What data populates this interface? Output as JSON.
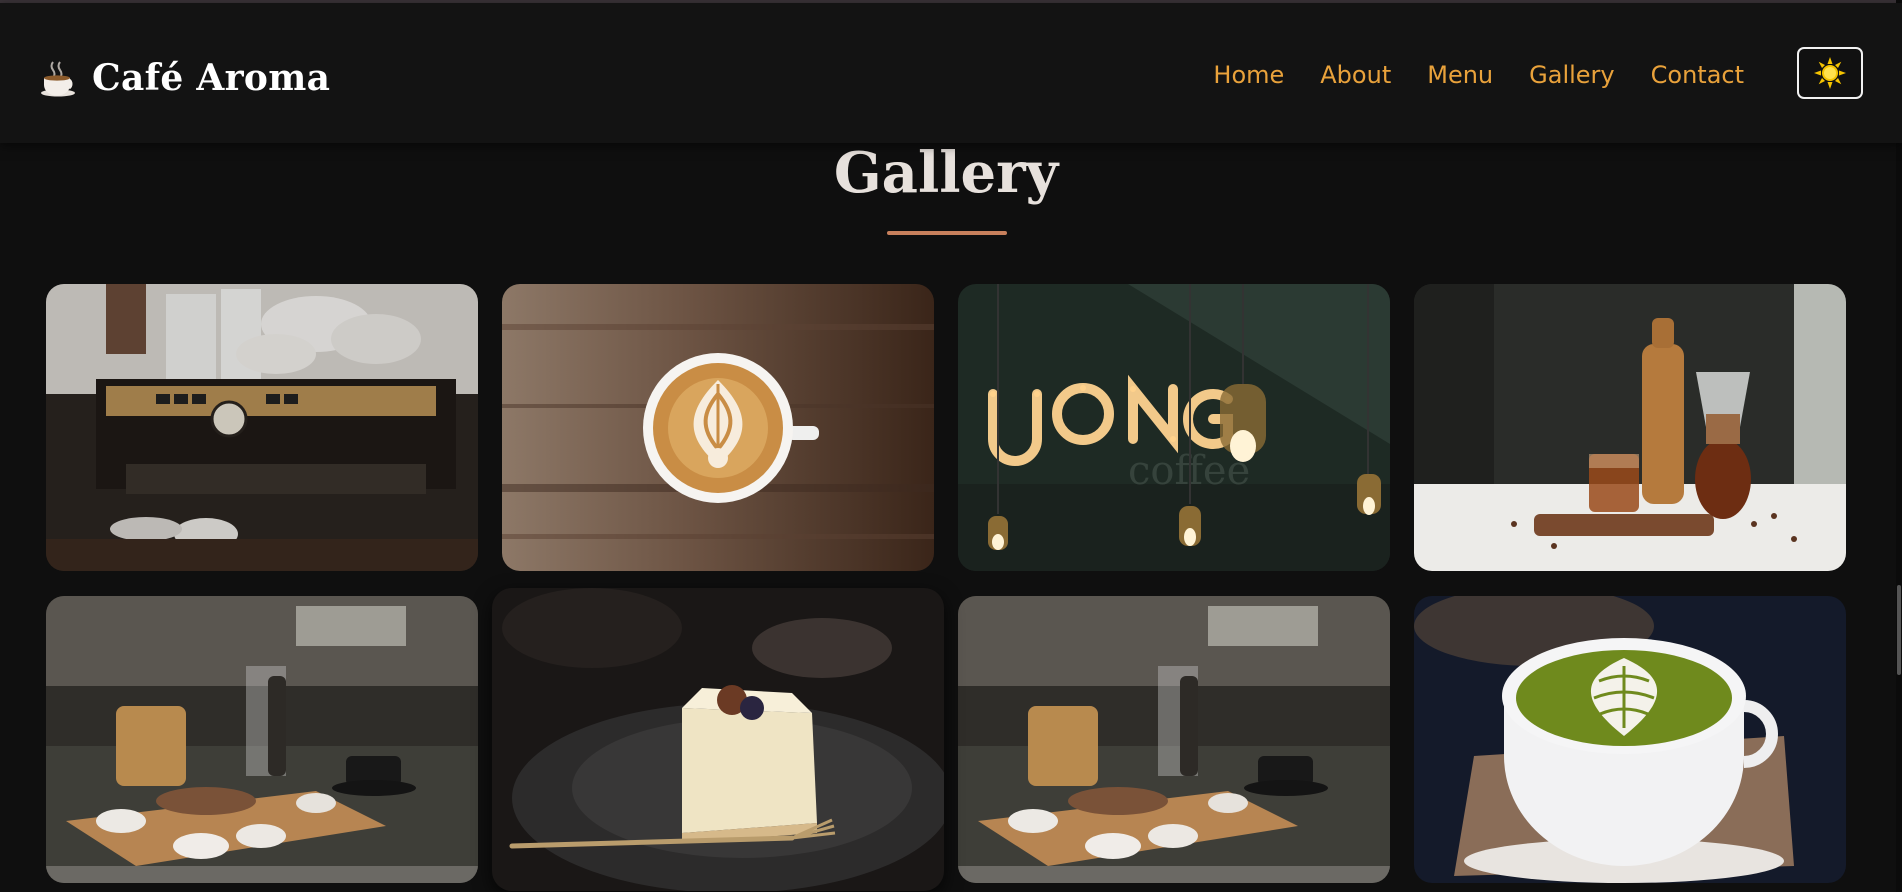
{
  "brand": {
    "name": "Café Aroma",
    "icon": "coffee-cup-icon"
  },
  "nav": {
    "links": [
      "Home",
      "About",
      "Menu",
      "Gallery",
      "Contact"
    ],
    "theme_toggle_icon": "sun-icon"
  },
  "gallery": {
    "title": "Gallery",
    "accent_color": "#c8805c",
    "images": [
      "espresso-machine-photo",
      "latte-art-wood-table-photo",
      "neon-cafe-sign-pendant-lights-photo",
      "cold-brew-bottle-tray-photo",
      "cafe-table-snacks-photo",
      "cheesecake-slice-plate-photo",
      "cafe-table-snacks-photo",
      "matcha-latte-art-photo"
    ]
  },
  "colors": {
    "nav_link": "#e9a23b",
    "background": "#0f0f0f",
    "navbar": "#131313"
  }
}
